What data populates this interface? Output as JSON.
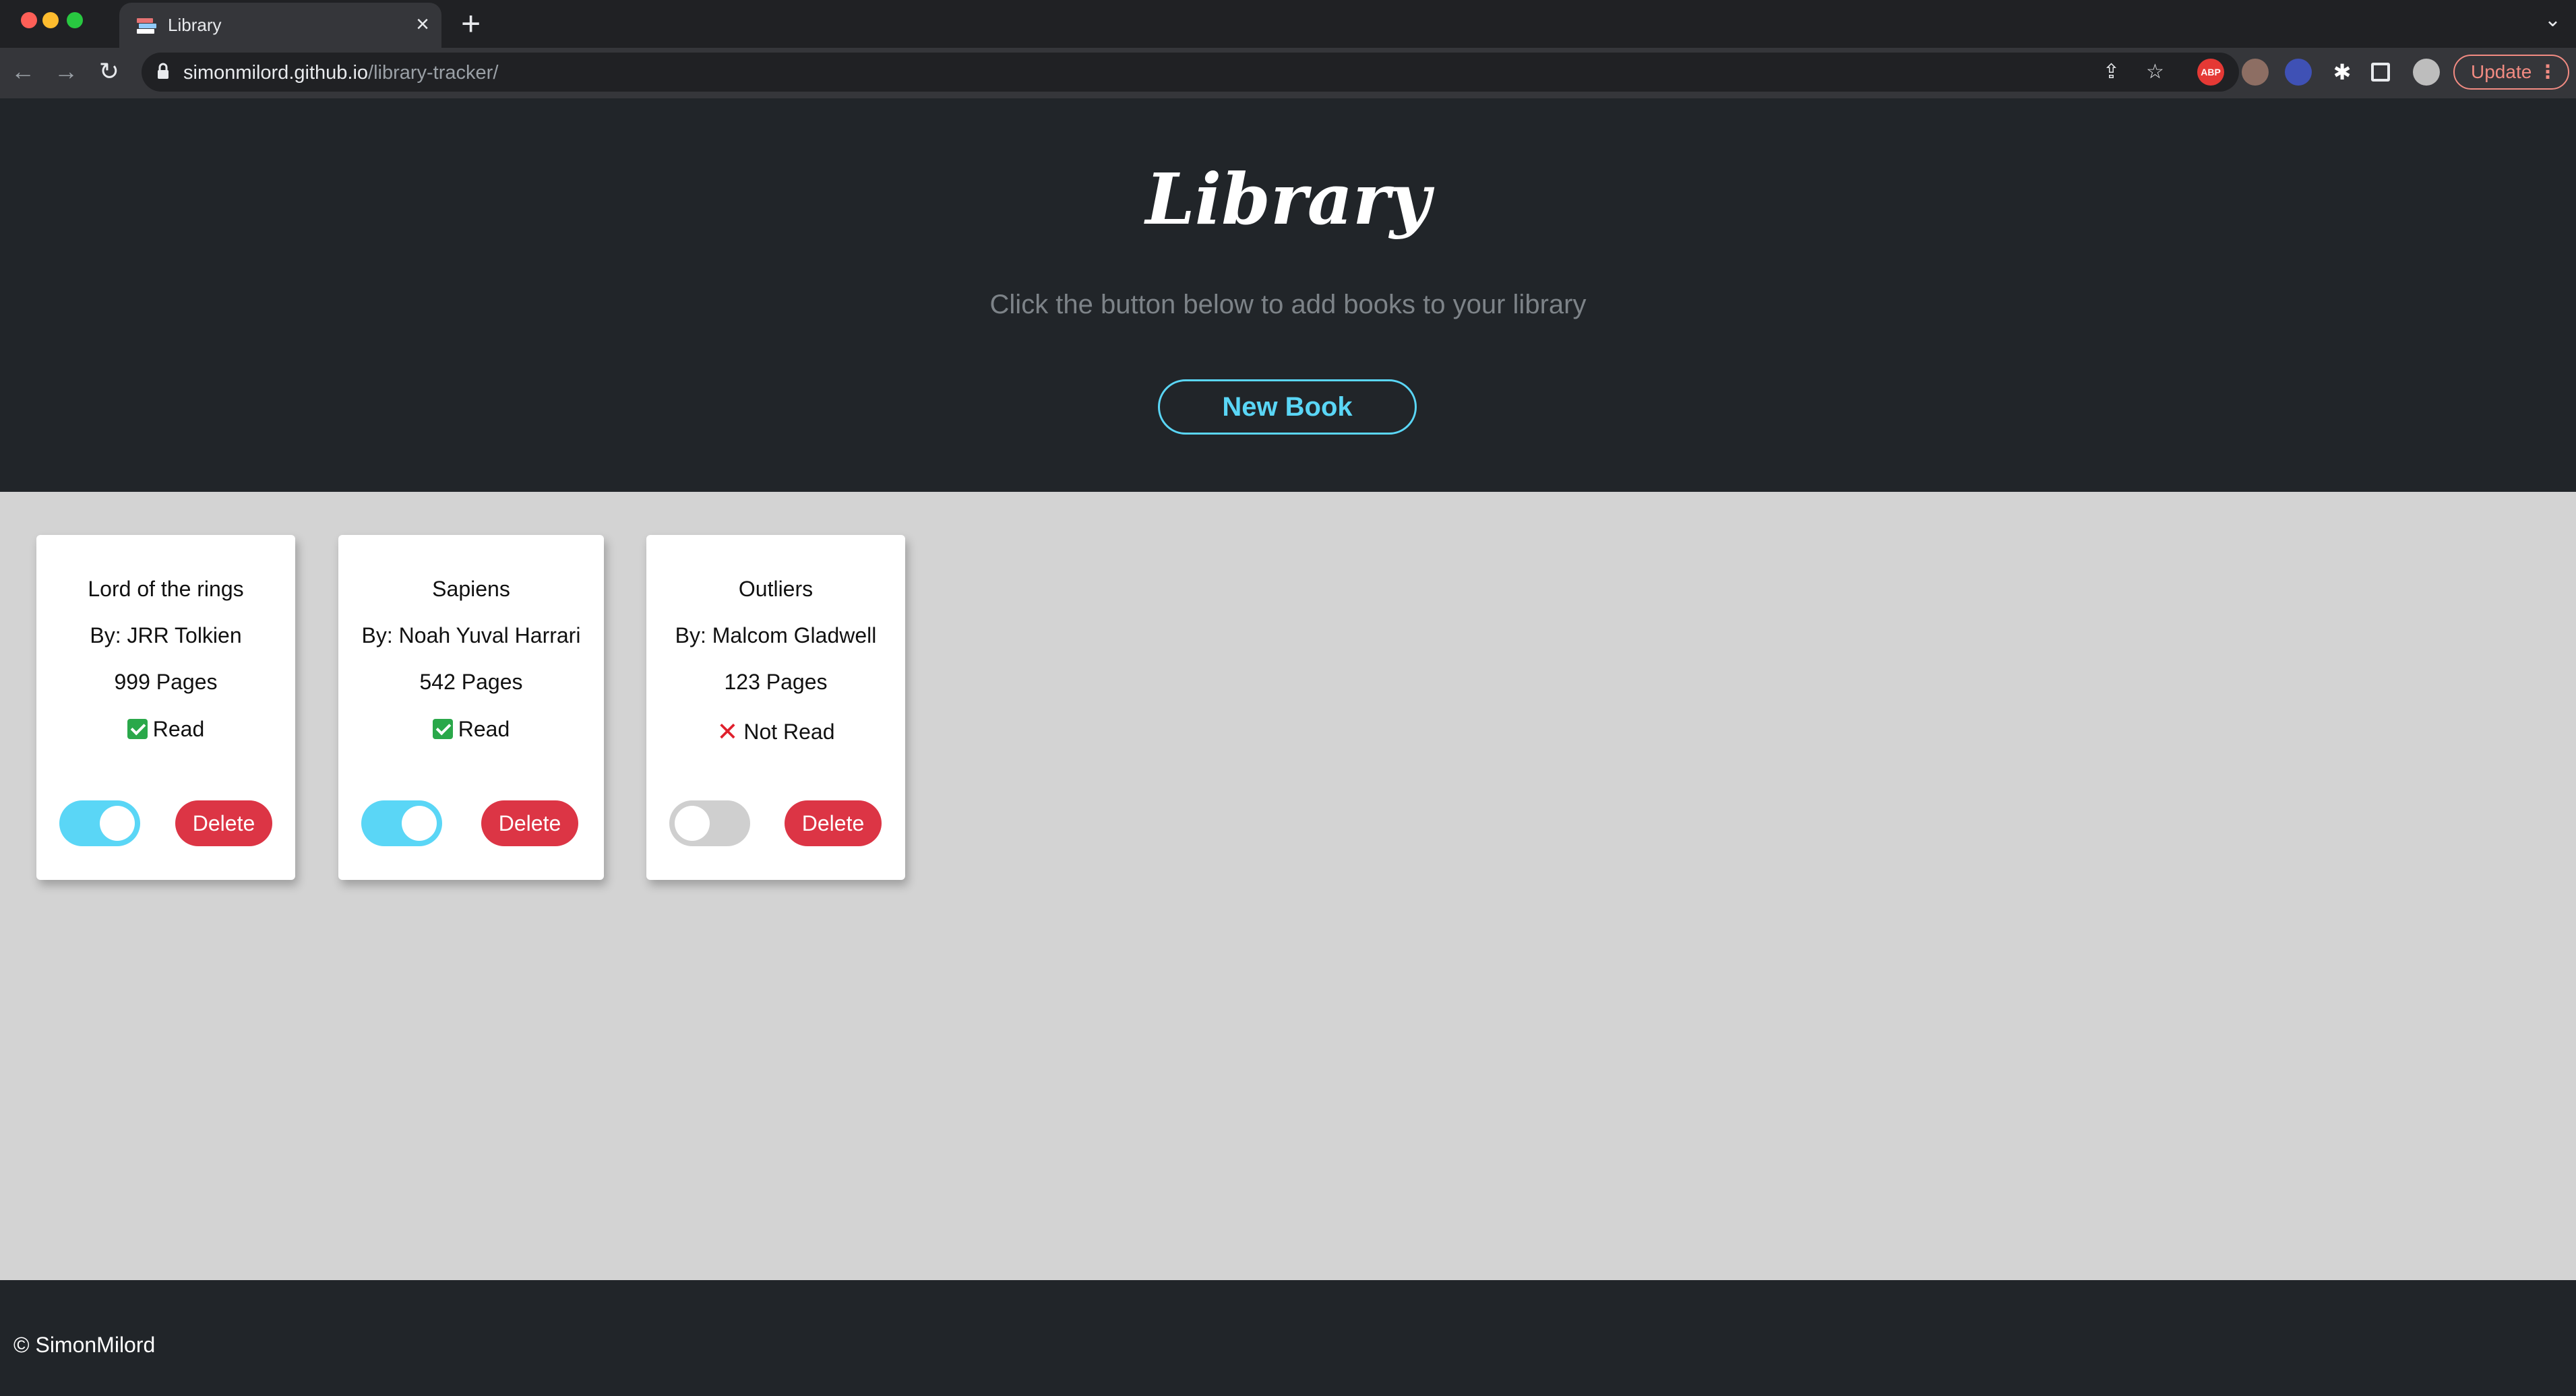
{
  "browser": {
    "tab_title": "Library",
    "tab_close": "×",
    "new_tab": "+",
    "url_host": "simonmilord.github.io",
    "url_path": "/library-tracker/",
    "update_label": "Update",
    "update_dots": "⋮"
  },
  "header": {
    "logo": "Library",
    "subtitle": "Click the button below to add books to your library",
    "new_book_label": "New Book"
  },
  "books": [
    {
      "title": "Lord of the rings",
      "author": "By: JRR Tolkien",
      "pages": "999 Pages",
      "status": "Read",
      "read": true,
      "delete_label": "Delete"
    },
    {
      "title": "Sapiens",
      "author": "By: Noah Yuval Harrari",
      "pages": "542 Pages",
      "status": "Read",
      "read": true,
      "delete_label": "Delete"
    },
    {
      "title": "Outliers",
      "author": "By: Malcom Gladwell",
      "pages": "123 Pages",
      "status": "Not Read",
      "read": false,
      "delete_label": "Delete"
    }
  ],
  "footer": {
    "text": "© SimonMilord"
  },
  "colors": {
    "accent": "#5ad6f6",
    "danger": "#dc3545",
    "header_bg": "#212529",
    "main_bg": "#d3d3d3"
  }
}
